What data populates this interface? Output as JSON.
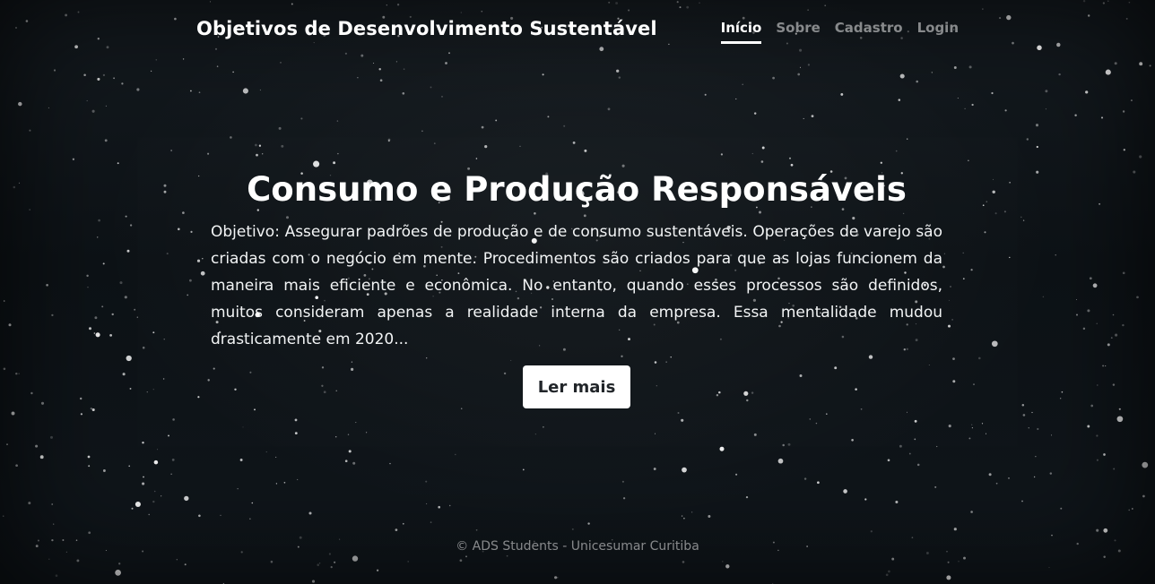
{
  "header": {
    "brand": "Objetivos de Desenvolvimento Sustentável",
    "nav": [
      {
        "label": "Início",
        "active": true
      },
      {
        "label": "Sobre",
        "active": false
      },
      {
        "label": "Cadastro",
        "active": false
      },
      {
        "label": "Login",
        "active": false
      }
    ]
  },
  "hero": {
    "title": "Consumo e Produção Responsáveis",
    "text": "Objetivo: Assegurar padrões de produção e de consumo sustentáveis. Operações de varejo são criadas com o negócio em mente. Procedimentos são criados para que as lojas funcionem da maneira mais eficiente e econômica. No entanto, quando esses processos são definidos, muitos consideram apenas a realidade interna da empresa. Essa mentalidade mudou drasticamente em 2020...",
    "button_label": "Ler mais"
  },
  "footer": {
    "text": "© ADS Students - Unicesumar Curitiba"
  },
  "theme": {
    "background": "#0d1216",
    "text": "#ffffff",
    "muted_text": "#8a8f93",
    "button_bg": "#ffffff",
    "button_text": "#212529"
  }
}
